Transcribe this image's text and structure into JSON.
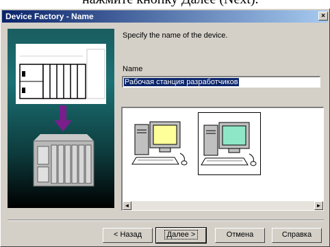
{
  "caption_fragment": "нажмите кнопку Далее (Next).",
  "window": {
    "title": "Device Factory - Name",
    "close_glyph": "×"
  },
  "prompt_text": "Specify the name of the device.",
  "name_field": {
    "label": "Name",
    "value": "Рабочая станция разработчиков"
  },
  "device_icons": [
    {
      "icon": "workstation-yellow-screen-icon",
      "screen_color": "#ffff99",
      "selected": false
    },
    {
      "icon": "workstation-green-screen-icon",
      "screen_color": "#8ee8c8",
      "selected": true
    }
  ],
  "scrollbar": {
    "left_glyph": "◄",
    "right_glyph": "►"
  },
  "buttons": {
    "back": "< Назад",
    "next": "Далее >",
    "cancel": "Отмена",
    "help": "Справка"
  },
  "colors": {
    "title_gradient_start": "#0a246a",
    "title_gradient_end": "#a6caf0",
    "selection": "#0a246a",
    "arrow": "#7a1e8c"
  }
}
